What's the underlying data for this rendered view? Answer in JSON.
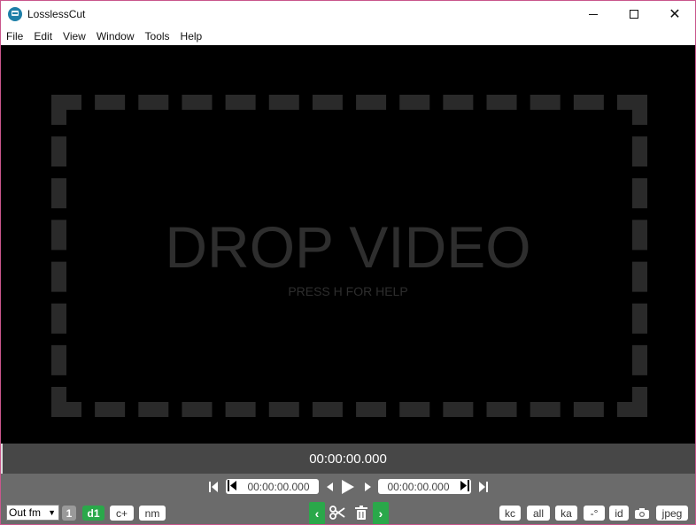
{
  "window": {
    "title": "LosslessCut"
  },
  "menu": [
    "File",
    "Edit",
    "View",
    "Window",
    "Tools",
    "Help"
  ],
  "video": {
    "drop_text": "DROP VIDEO",
    "help_text": "PRESS H FOR HELP"
  },
  "timebar": {
    "current_time": "00:00:00.000"
  },
  "controls": {
    "cut_start_time": "00:00:00.000",
    "cut_end_time": "00:00:00.000",
    "output_format": "Out fm",
    "segment_number": "1",
    "left_buttons": {
      "d1": "d1",
      "cplus": "c+",
      "nm": "nm"
    },
    "right_buttons": {
      "kc": "kc",
      "all": "all",
      "ka": "ka",
      "offset": "-°",
      "id": "id",
      "jpeg": "jpeg"
    }
  },
  "icons": {
    "jump_start": "skip-start-icon",
    "set_cut_start": "cut-start-icon",
    "prev_frame": "prev-frame-icon",
    "play": "play-icon",
    "next_frame": "next-frame-icon",
    "set_cut_end": "cut-end-icon",
    "jump_end": "skip-end-icon",
    "cut": "scissors-icon",
    "delete": "trash-icon",
    "screenshot": "camera-icon"
  },
  "colors": {
    "accent_green": "#2aa84a",
    "video_bg": "#000000",
    "timebar_bg": "#474747",
    "controls_bg": "#6b6b6b"
  }
}
